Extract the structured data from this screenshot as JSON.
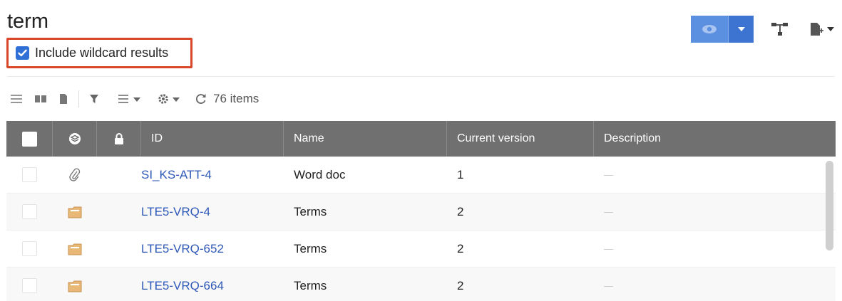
{
  "page": {
    "title": "term"
  },
  "wildcard": {
    "label": "Include wildcard results",
    "checked": true
  },
  "toolbar": {
    "count_label": "76 items",
    "view_icons": [
      "list-view-icon",
      "book-view-icon",
      "document-view-icon"
    ],
    "other_icons": [
      "filter-icon",
      "column-list-icon",
      "settings-icon",
      "refresh-icon"
    ]
  },
  "top_actions": {
    "icons": [
      "eye-icon",
      "chevron-down-icon",
      "structure-icon",
      "export-icon"
    ]
  },
  "table": {
    "columns": [
      "ID",
      "Name",
      "Current version",
      "Description"
    ],
    "rows": [
      {
        "type": "attachment",
        "id": "SI_KS-ATT-4",
        "name": "Word doc",
        "version": "1",
        "description": "—"
      },
      {
        "type": "folder",
        "id": "LTE5-VRQ-4",
        "name": "Terms",
        "version": "2",
        "description": "—"
      },
      {
        "type": "folder",
        "id": "LTE5-VRQ-652",
        "name": "Terms",
        "version": "2",
        "description": "—"
      },
      {
        "type": "folder",
        "id": "LTE5-VRQ-664",
        "name": "Terms",
        "version": "2",
        "description": "—"
      }
    ]
  },
  "colors": {
    "accent": "#2f6fd6",
    "header_bg": "#707070",
    "link": "#2e58b7",
    "highlight_border": "#d9472b",
    "folder": "#e8b877"
  }
}
